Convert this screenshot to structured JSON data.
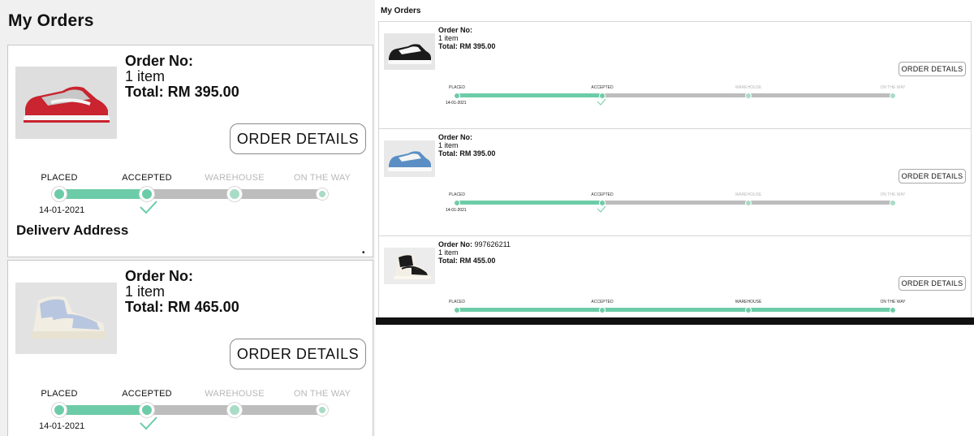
{
  "colors": {
    "progress_active": "#6dcca8",
    "progress_inactive": "#bdbdbd",
    "page_bg": "#f0f0f0"
  },
  "left": {
    "page_title": "My Orders",
    "orders": [
      {
        "order_no_label": "Order No:",
        "items": "1 item",
        "total": "Total: RM 395.00",
        "details_button": "ORDER DETAILS",
        "steps": [
          "PLACED",
          "ACCEPTED",
          "WAREHOUSE",
          "ON THE WAY"
        ],
        "date": "14-01-2021",
        "shoe_colors": [
          "#c9242f",
          "#c8c8c8"
        ]
      },
      {
        "order_no_label": "Order No:",
        "items": "1 item",
        "total": "Total: RM 465.00",
        "details_button": "ORDER DETAILS",
        "steps": [
          "PLACED",
          "ACCEPTED",
          "WAREHOUSE",
          "ON THE WAY"
        ],
        "date": "14-01-2021",
        "shoe_colors": [
          "#b9c6df",
          "#f1ede3"
        ]
      }
    ],
    "delivery_address_heading": "Deliverv Address"
  },
  "right": {
    "page_title": "My Orders",
    "orders": [
      {
        "order_no_label": "Order No:",
        "order_no_value": "",
        "items": "1 item",
        "total": "Total: RM 395.00",
        "details_button": "ORDER DETAILS",
        "steps": [
          "PLACED",
          "ACCEPTED",
          "WAREHOUSE",
          "ON THE WAY"
        ],
        "date": "14-01-2021",
        "progress_steps_done": 2
      },
      {
        "order_no_label": "Order No:",
        "order_no_value": "",
        "items": "1 item",
        "total": "Total: RM 395.00",
        "details_button": "ORDER DETAILS",
        "steps": [
          "PLACED",
          "ACCEPTED",
          "WAREHOUSE",
          "ON THE WAY"
        ],
        "date": "14-01-2021",
        "progress_steps_done": 2
      },
      {
        "order_no_label": "Order No:",
        "order_no_value": "997626211",
        "items": "1 item",
        "total": "Total: RM 455.00",
        "details_button": "ORDER DETAILS",
        "steps": [
          "PLACED",
          "ACCEPTED",
          "WAREHOUSE",
          "ON THE WAY"
        ],
        "date": "",
        "progress_steps_done": 4
      }
    ]
  }
}
